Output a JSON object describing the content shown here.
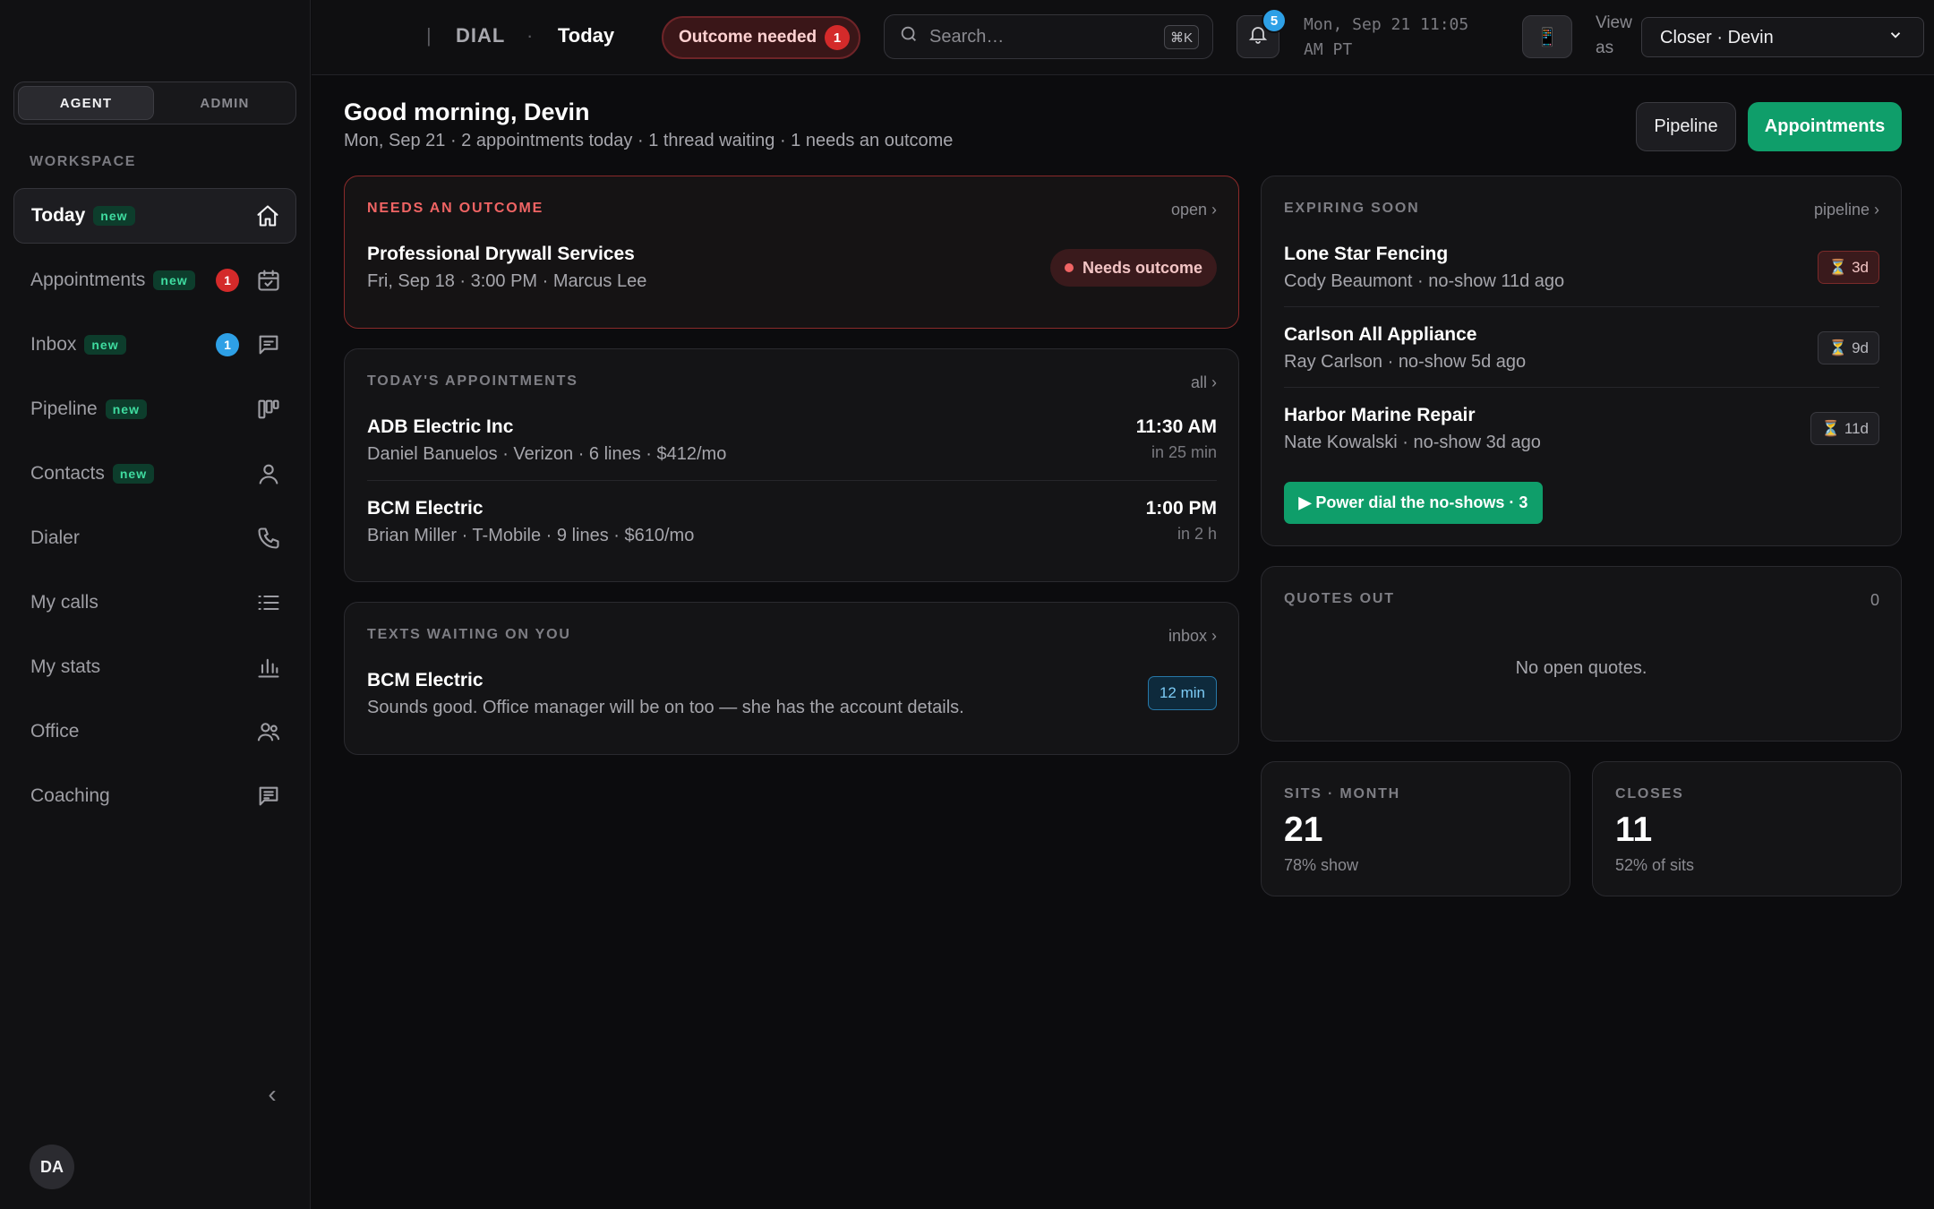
{
  "sidebar": {
    "roles": [
      "AGENT",
      "ADMIN"
    ],
    "workspace_label": "WORKSPACE",
    "new_tag": "new",
    "items": [
      {
        "label": "Today",
        "new": true,
        "count": null,
        "icon": "home-icon"
      },
      {
        "label": "Appointments",
        "new": true,
        "count": "1",
        "icon": "calendar-check-icon"
      },
      {
        "label": "Inbox",
        "new": true,
        "count": "1",
        "icon": "message-icon"
      },
      {
        "label": "Pipeline",
        "new": true,
        "count": null,
        "icon": "kanban-icon"
      },
      {
        "label": "Contacts",
        "new": true,
        "count": null,
        "icon": "person-icon"
      },
      {
        "label": "Dialer",
        "new": false,
        "count": null,
        "icon": "phone-icon"
      },
      {
        "label": "My calls",
        "new": false,
        "count": null,
        "icon": "list-icon"
      },
      {
        "label": "My stats",
        "new": false,
        "count": null,
        "icon": "bar-chart-icon"
      },
      {
        "label": "Office",
        "new": false,
        "count": null,
        "icon": "people-icon"
      },
      {
        "label": "Coaching",
        "new": false,
        "count": null,
        "icon": "chat-icon"
      }
    ],
    "avatar": "DA"
  },
  "topbar": {
    "brand_sep": "|",
    "brand": "DIAL",
    "dot": "·",
    "crumb": "Today",
    "outcome_label": "Outcome needed",
    "outcome_count": "1",
    "search_placeholder": "Search…",
    "search_kbd": "⌘K",
    "bell_count": "5",
    "clock_line1": "Mon, Sep 21 11:05",
    "clock_line2": "AM PT",
    "phone_icon": "📱",
    "viewas_line1": "View",
    "viewas_line2": "as",
    "role_selected": "Closer · Devin"
  },
  "header": {
    "greeting": "Good morning, Devin",
    "summary": "Mon, Sep 21 · 2 appointments today · 1 thread waiting · 1 needs an outcome",
    "pipeline_btn": "Pipeline",
    "appointments_btn": "Appointments"
  },
  "needs_outcome": {
    "title": "NEEDS AN OUTCOME",
    "link": "open ›",
    "name": "Professional Drywall Services",
    "meta": "Fri, Sep 18 · 3:00 PM · Marcus Lee",
    "pill": "Needs outcome"
  },
  "todays_appointments": {
    "title": "TODAY'S APPOINTMENTS",
    "link": "all ›",
    "rows": [
      {
        "name": "ADB Electric Inc",
        "meta": "Daniel Banuelos · Verizon · 6 lines · $412/mo",
        "time": "11:30 AM",
        "rel": "in 25 min"
      },
      {
        "name": "BCM Electric",
        "meta": "Brian Miller · T-Mobile · 9 lines · $610/mo",
        "time": "1:00 PM",
        "rel": "in 2 h"
      }
    ]
  },
  "texts_waiting": {
    "title": "TEXTS WAITING ON YOU",
    "link": "inbox ›",
    "name": "BCM Electric",
    "message": "Sounds good. Office manager will be on too — she has the account details.",
    "badge": "12 min"
  },
  "expiring_soon": {
    "title": "EXPIRING SOON",
    "link": "pipeline ›",
    "rows": [
      {
        "name": "Lone Star Fencing",
        "meta": "Cody Beaumont · no-show 11d ago",
        "badge": "⏳ 3d",
        "hot": true
      },
      {
        "name": "Carlson All Appliance",
        "meta": "Ray Carlson · no-show 5d ago",
        "badge": "⏳ 9d",
        "hot": false
      },
      {
        "name": "Harbor Marine Repair",
        "meta": "Nate Kowalski · no-show 3d ago",
        "badge": "⏳ 11d",
        "hot": false
      }
    ],
    "power_btn": "▶ Power dial the no-shows · 3"
  },
  "quotes_out": {
    "title": "QUOTES OUT",
    "count": "0",
    "empty": "No open quotes."
  },
  "stats": [
    {
      "title": "SITS · MONTH",
      "value": "21",
      "sub": "78% show"
    },
    {
      "title": "CLOSES",
      "value": "11",
      "sub": "52% of sits"
    }
  ],
  "colors": {
    "accent": "#0f9e6a",
    "alert": "#f06464",
    "badge_red": "#d42a2a",
    "badge_blue": "#2ea0e6"
  }
}
